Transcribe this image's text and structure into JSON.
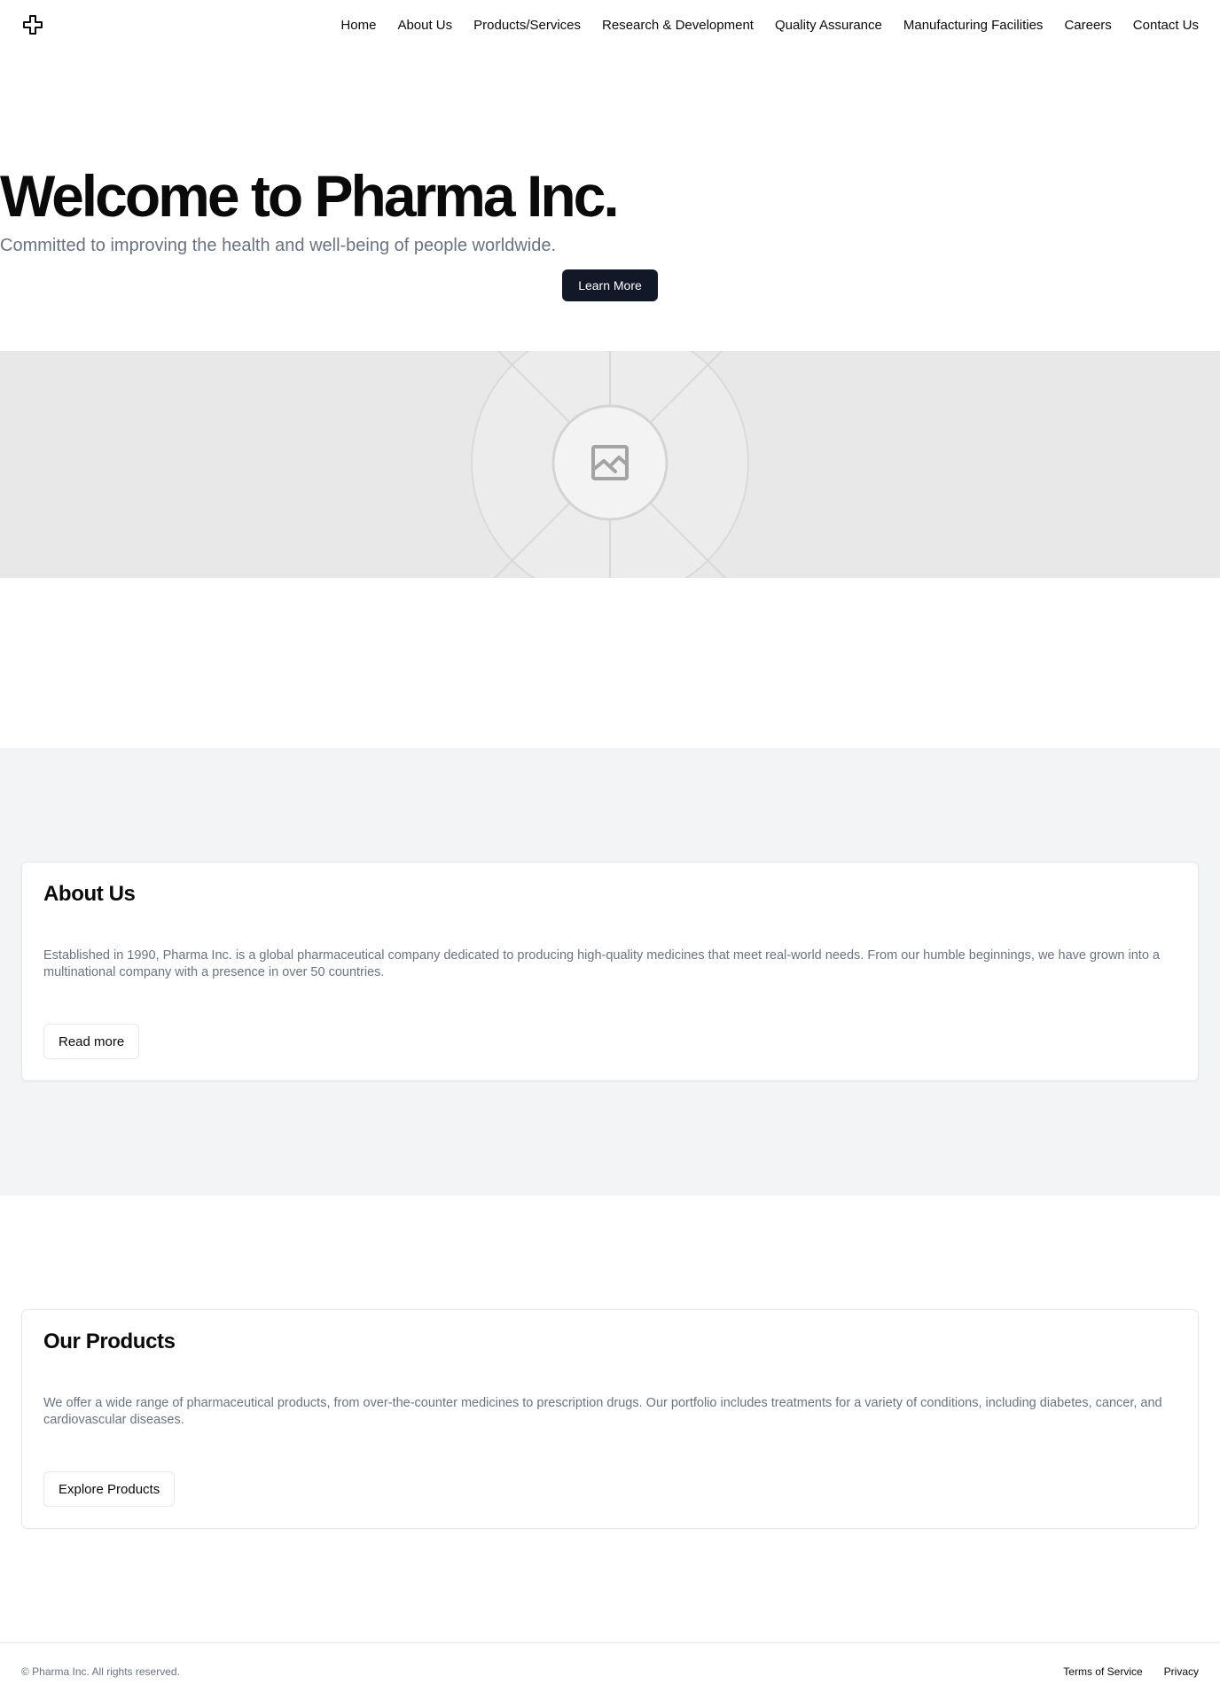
{
  "header": {
    "logo_icon": "medical-cross-icon",
    "nav": [
      {
        "label": "Home"
      },
      {
        "label": "About Us"
      },
      {
        "label": "Products/Services"
      },
      {
        "label": "Research & Development"
      },
      {
        "label": "Quality Assurance"
      },
      {
        "label": "Manufacturing Facilities"
      },
      {
        "label": "Careers"
      },
      {
        "label": "Contact Us"
      }
    ]
  },
  "hero": {
    "title": "Welcome to Pharma Inc.",
    "subtitle": "Committed to improving the health and well-being of people worldwide.",
    "button_label": "Learn More",
    "image_icon": "image-placeholder-icon"
  },
  "about": {
    "title": "About Us",
    "text": "Established in 1990, Pharma Inc. is a global pharmaceutical company dedicated to producing high-quality medicines that meet real-world needs. From our humble beginnings, we have grown into a multinational company with a presence in over 50 countries.",
    "button_label": "Read more"
  },
  "products": {
    "title": "Our Products",
    "text": "We offer a wide range of pharmaceutical products, from over-the-counter medicines to prescription drugs. Our portfolio includes treatments for a variety of conditions, including diabetes, cancer, and cardiovascular diseases.",
    "button_label": "Explore Products"
  },
  "footer": {
    "copyright": "© Pharma Inc. All rights reserved.",
    "links": [
      {
        "label": "Terms of Service"
      },
      {
        "label": "Privacy"
      }
    ]
  },
  "colors": {
    "primary_button": "#111827",
    "muted_text": "#6b7280",
    "section_bg": "#f3f4f6",
    "border": "#e5e7eb"
  }
}
